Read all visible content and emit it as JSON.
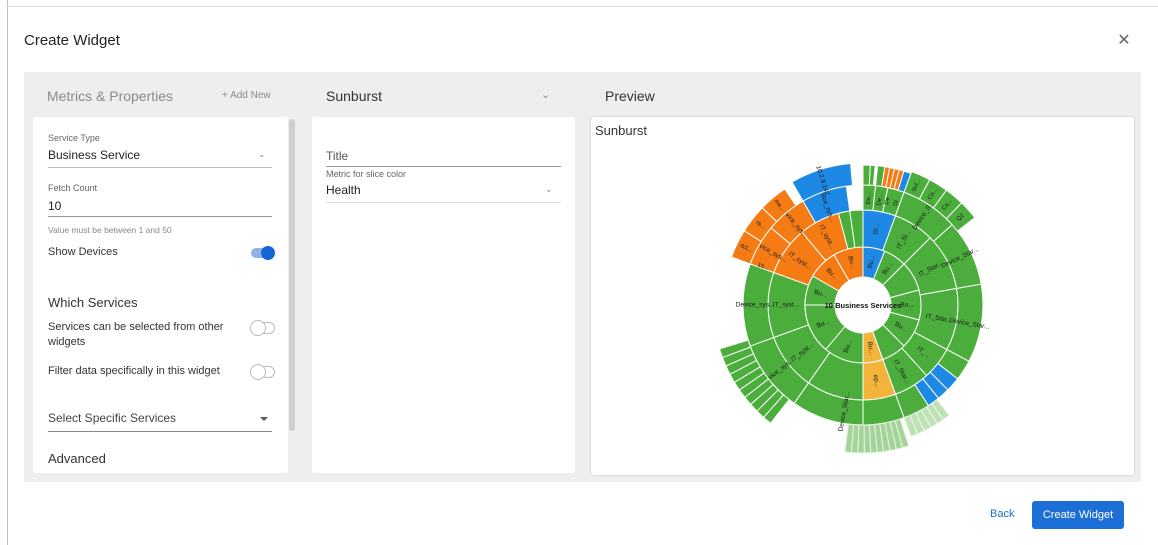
{
  "dialog": {
    "title": "Create Widget",
    "close_icon": "close-icon"
  },
  "columns": {
    "metrics_header": "Metrics & Properties",
    "add_new": "+ Add New",
    "chart_type": "Sunburst",
    "preview_header": "Preview"
  },
  "left_panel": {
    "service_type_label": "Service Type",
    "service_type_value": "Business Service",
    "fetch_count_label": "Fetch Count",
    "fetch_count_value": "10",
    "fetch_count_help": "Value must be between 1 and 50",
    "show_devices_label": "Show Devices",
    "show_devices_on": true,
    "which_services_heading": "Which Services",
    "services_other_widgets_label": "Services can be selected from other widgets",
    "services_other_widgets_on": false,
    "filter_widget_label": "Filter data specifically in this widget",
    "filter_widget_on": false,
    "select_services_placeholder": "Select Specific Services",
    "advanced_heading": "Advanced"
  },
  "middle_panel": {
    "title_placeholder": "Title",
    "slice_color_label": "Metric for slice color",
    "slice_color_value": "Health"
  },
  "preview": {
    "chart_title": "Sunburst",
    "center_label": "10 Business Services",
    "labels": {
      "ring1": [
        "Bu...",
        "Bu...",
        "Bu...",
        "Bu...",
        "Bu...",
        "Bu...",
        "Bu...",
        "Bu...",
        "Bu...",
        "Bu..."
      ],
      "ring2": [
        "IT_Sl...",
        "IT_Star...",
        "IT_Star...",
        "IT_...",
        "ep...",
        "IT_Star...",
        "IT_syst...",
        "IT_syst...",
        "IT_syst...",
        "IT_syst...",
        "Sr..."
      ],
      "ring3": [
        "Device_S...",
        "Device_Star...",
        "Device_Star...",
        "Device_Star...",
        "Device_sys...",
        "Device_sys...",
        "Device_sys...",
        "Device_sys...",
        "Device_sys..."
      ],
      "small": [
        "Ca...",
        "Ca...",
        "Q2",
        "Scl...",
        "De...",
        "De...",
        "De",
        "10.2.8.142",
        "me...",
        "re...",
        "dcl...",
        "10...",
        "Di",
        "10..."
      ]
    },
    "colors": {
      "healthy": "#4bad3c",
      "warning": "#f39a1c",
      "critical": "#f57c14",
      "info": "#1e88e5",
      "minor": "#f2b43a"
    }
  },
  "footer": {
    "back_label": "Back",
    "create_label": "Create Widget"
  }
}
